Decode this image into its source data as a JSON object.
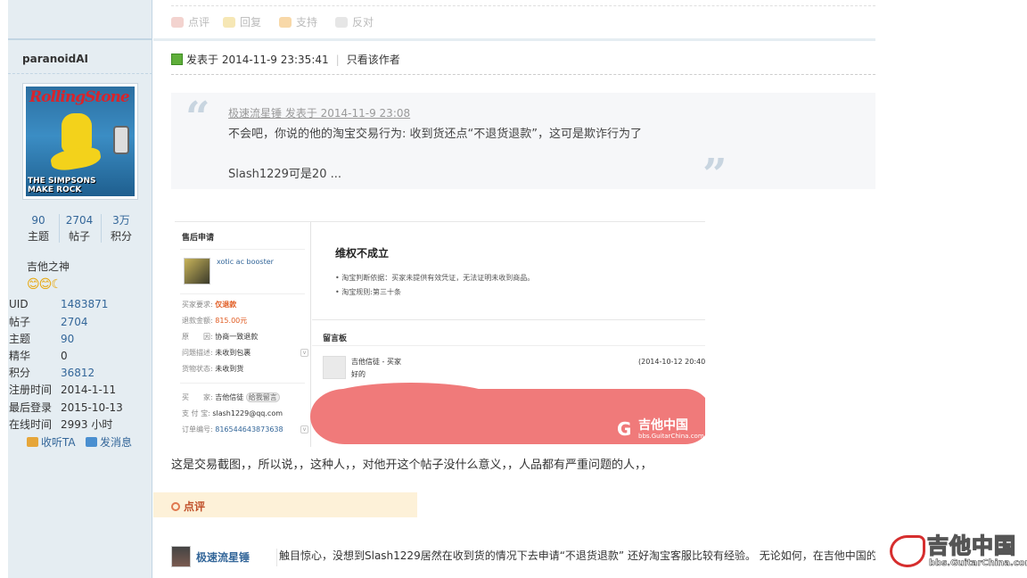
{
  "actions": {
    "rate": "点评",
    "reply": "回复",
    "support": "支持",
    "oppose": "反对"
  },
  "sidebar": {
    "username": "paranoidAI",
    "avatar_text": {
      "masthead": "RollingStone",
      "footer_line1": "THE SIMPSONS",
      "footer_line2": "MAKE ROCK"
    },
    "stats": [
      {
        "value": "90",
        "label": "主题"
      },
      {
        "value": "2704",
        "label": "帖子"
      },
      {
        "value": "3万",
        "label": "积分"
      }
    ],
    "rank": "吉他之神",
    "rank_icons": "😊😊☾",
    "info": [
      {
        "key": "UID",
        "value": "1483871"
      },
      {
        "key": "帖子",
        "value": "2704"
      },
      {
        "key": "主题",
        "value": "90"
      },
      {
        "key": "精华",
        "value": "0"
      },
      {
        "key": "积分",
        "value": "36812"
      },
      {
        "key": "注册时间",
        "value": "2014-1-11"
      },
      {
        "key": "最后登录",
        "value": "2015-10-13"
      },
      {
        "key": "在线时间",
        "value": "2993 小时"
      }
    ],
    "follow": "收听TA",
    "message": "发消息"
  },
  "post": {
    "posted_at": "发表于 2014-11-9 23:35:41",
    "only_author": "只看该作者",
    "quote": {
      "author_line": "极速流星锤 发表于 2014-11-9 23:08",
      "line1": "不会吧，你说的他的淘宝交易行为: 收到货还点“不退货退款”，这可是欺诈行为了",
      "line2": "Slash1229可是20 ..."
    },
    "body": "这是交易截图，，所以说，，这种人，，对他开这个帖子没什么意义，，人品都有严重问题的人，，"
  },
  "screenshot": {
    "panel_title": "售后申请",
    "product": "xotic ac booster",
    "rows": [
      {
        "k": "买家要求:",
        "v": "仅退款"
      },
      {
        "k": "退款金额:",
        "v": "815.00元"
      },
      {
        "k": "原　　因:",
        "v": "协商一致退款"
      },
      {
        "k": "问题描述:",
        "v": "未收到包裹"
      },
      {
        "k": "货物状态:",
        "v": "未收到货"
      }
    ],
    "buyer_key": "买　　家:",
    "buyer_val": "吉他信徒",
    "buyer_btn": "给我留言",
    "alipay_key": "支 付 宝:",
    "alipay_val": "slash1229@qq.com",
    "order_key": "订单编号:",
    "order_val": "816544643873638",
    "result_title": "维权不成立",
    "result_1": "淘宝判断依据：买家未提供有效凭证，无法证明未收到商品。",
    "result_2": "淘宝规则:第三十条",
    "board_title": "留言板",
    "msg_user": "吉他信徒 - 买家",
    "msg_time": "(2014-10-12 20:40:51",
    "msg_text": "好的",
    "logo_main": "吉他中国",
    "logo_sub": "bbs.GuitarChina.com"
  },
  "comments": {
    "label": "点评",
    "items": [
      {
        "user": "极速流星锤",
        "text": "触目惊心，没想到Slash1229居然在收到货的情况下去申请“不退货退款” 还好淘宝客服比较有经验。 无论如何，在吉他中国的监"
      }
    ]
  },
  "watermark": {
    "main": "吉他中国",
    "sub": "bbs.GuitarChina.com"
  }
}
